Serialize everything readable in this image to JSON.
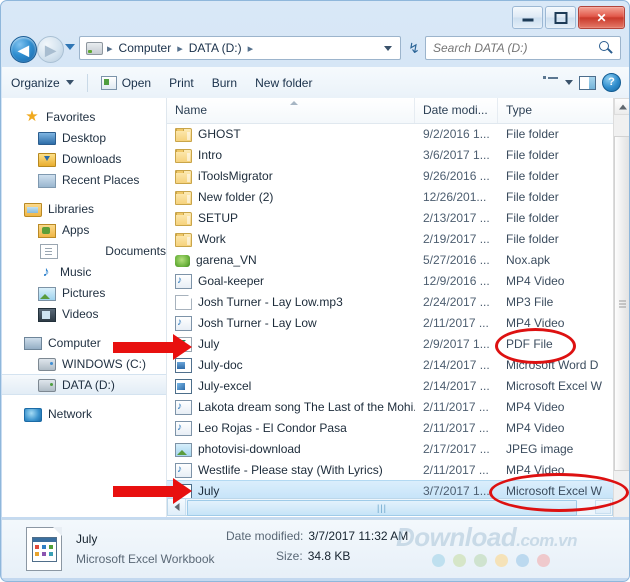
{
  "window": {
    "controls": {
      "minimize_label": "Minimize",
      "maximize_label": "Maximize",
      "close_label": "Close",
      "close_glyph": "✕"
    }
  },
  "address_bar": {
    "back_label": "Back",
    "forward_label": "Forward",
    "back_glyph": "◀",
    "forward_glyph": "▶",
    "crumbs": [
      "Computer",
      "DATA (D:)"
    ],
    "separator": "▸",
    "refresh_glyph": "↯"
  },
  "search": {
    "placeholder": "Search DATA (D:)",
    "value": ""
  },
  "toolbar": {
    "organize_label": "Organize",
    "open_label": "Open",
    "print_label": "Print",
    "burn_label": "Burn",
    "new_folder_label": "New folder",
    "help_glyph": "?"
  },
  "nav_pane": {
    "groups": [
      {
        "header": {
          "label": "Favorites",
          "icon": "star-icon"
        },
        "items": [
          {
            "label": "Desktop",
            "icon": "desktop-icon"
          },
          {
            "label": "Downloads",
            "icon": "downloads-icon"
          },
          {
            "label": "Recent Places",
            "icon": "recent-places-icon"
          }
        ]
      },
      {
        "header": {
          "label": "Libraries",
          "icon": "libraries-icon"
        },
        "items": [
          {
            "label": "Apps",
            "icon": "apps-icon"
          },
          {
            "label": "Documents",
            "icon": "documents-icon"
          },
          {
            "label": "Music",
            "icon": "music-icon"
          },
          {
            "label": "Pictures",
            "icon": "pictures-icon"
          },
          {
            "label": "Videos",
            "icon": "videos-icon"
          }
        ]
      },
      {
        "header": {
          "label": "Computer",
          "icon": "computer-icon"
        },
        "items": [
          {
            "label": "WINDOWS (C:)",
            "icon": "hard-drive-icon",
            "selected": false
          },
          {
            "label": "DATA (D:)",
            "icon": "hard-drive-icon",
            "selected": true
          }
        ]
      },
      {
        "header": {
          "label": "Network",
          "icon": "network-icon"
        },
        "items": []
      }
    ]
  },
  "file_list": {
    "columns": [
      {
        "key": "name",
        "label": "Name",
        "sorted": true
      },
      {
        "key": "date",
        "label": "Date modi..."
      },
      {
        "key": "type",
        "label": "Type"
      }
    ],
    "rows": [
      {
        "name": "GHOST",
        "date": "9/2/2016 1...",
        "type": "File folder",
        "icon": "folder-icon",
        "selected": false
      },
      {
        "name": "Intro",
        "date": "3/6/2017 1...",
        "type": "File folder",
        "icon": "folder-icon",
        "selected": false
      },
      {
        "name": "iToolsMigrator",
        "date": "9/26/2016 ...",
        "type": "File folder",
        "icon": "folder-icon",
        "selected": false
      },
      {
        "name": "New folder (2)",
        "date": "12/26/201...",
        "type": "File folder",
        "icon": "folder-icon",
        "selected": false
      },
      {
        "name": "SETUP",
        "date": "2/13/2017 ...",
        "type": "File folder",
        "icon": "folder-icon",
        "selected": false
      },
      {
        "name": "Work",
        "date": "2/19/2017 ...",
        "type": "File folder",
        "icon": "folder-icon",
        "selected": false
      },
      {
        "name": "garena_VN",
        "date": "5/27/2016 ...",
        "type": "Nox.apk",
        "icon": "apk-icon",
        "selected": false
      },
      {
        "name": "Goal-keeper",
        "date": "12/9/2016 ...",
        "type": "MP4 Video",
        "icon": "video-icon",
        "selected": false
      },
      {
        "name": "Josh Turner - Lay Low.mp3",
        "date": "2/24/2017 ...",
        "type": "MP3 File",
        "icon": "blank-file-icon",
        "selected": false
      },
      {
        "name": "Josh Turner - Lay Low",
        "date": "2/11/2017 ...",
        "type": "MP4 Video",
        "icon": "video-icon",
        "selected": false
      },
      {
        "name": "July",
        "date": "2/9/2017 1...",
        "type": "PDF File",
        "icon": "pdf-icon",
        "selected": false
      },
      {
        "name": "July-doc",
        "date": "2/14/2017 ...",
        "type": "Microsoft Word D",
        "icon": "word-icon",
        "selected": false
      },
      {
        "name": "July-excel",
        "date": "2/14/2017 ...",
        "type": "Microsoft Excel W",
        "icon": "excel-icon",
        "selected": false
      },
      {
        "name": "Lakota dream song The Last of the Mohi...",
        "date": "2/11/2017 ...",
        "type": "MP4 Video",
        "icon": "video-icon",
        "selected": false
      },
      {
        "name": "Leo Rojas - El Condor Pasa",
        "date": "2/11/2017 ...",
        "type": "MP4 Video",
        "icon": "video-icon",
        "selected": false
      },
      {
        "name": "photovisi-download",
        "date": "2/17/2017 ...",
        "type": "JPEG image",
        "icon": "jpeg-icon",
        "selected": false
      },
      {
        "name": "Westlife - Please stay (With Lyrics)",
        "date": "2/11/2017 ...",
        "type": "MP4 Video",
        "icon": "video-icon",
        "selected": false
      },
      {
        "name": "July",
        "date": "3/7/2017 1...",
        "type": "Microsoft Excel W",
        "icon": "excel-icon",
        "selected": true
      }
    ]
  },
  "details_pane": {
    "file_name": "July",
    "file_type": "Microsoft Excel Workbook",
    "date_modified_label": "Date modified:",
    "date_modified_value": "3/7/2017 11:32 AM",
    "size_label": "Size:",
    "size_value": "34.8 KB"
  },
  "watermark": {
    "text": "Download",
    "suffix": ".com.vn",
    "dot_colors": [
      "#bfe0ef",
      "#d6e6c8",
      "#cfe3cf",
      "#f5e2b8",
      "#bcd9ef",
      "#efc9cc"
    ]
  },
  "annotations": {
    "arrow_color": "#e8100f",
    "ellipse_color": "#dd1111",
    "targets": [
      "July (PDF File)",
      "PDF File type",
      "July (Excel)",
      "Microsoft Excel W type"
    ]
  },
  "colors": {
    "accent": "#2f8ed0",
    "selection": "#c5e3f8",
    "window_chrome": "#cfe1f4"
  }
}
